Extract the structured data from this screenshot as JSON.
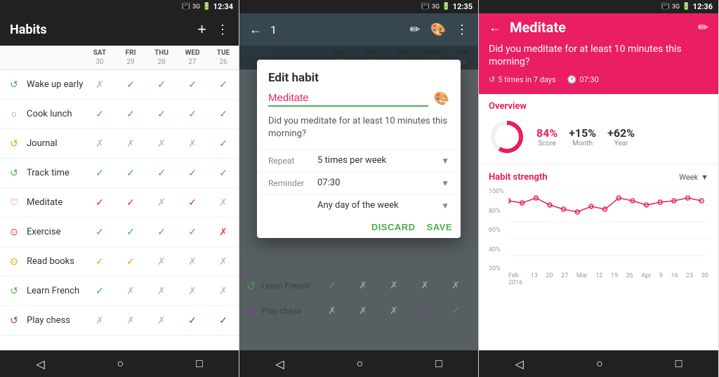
{
  "screen1": {
    "status_time": "12:34",
    "title": "Habits",
    "add_label": "+",
    "menu_label": "⋮",
    "columns": [
      {
        "day": "SAT",
        "num": "30"
      },
      {
        "day": "FRI",
        "num": "29"
      },
      {
        "day": "THU",
        "num": "28"
      },
      {
        "day": "WED",
        "num": "27"
      },
      {
        "day": "TUE",
        "num": "26"
      }
    ],
    "habits": [
      {
        "name": "Wake up early",
        "icon": "↺",
        "icon_color": "#4caf50",
        "checks": [
          "✗",
          "✓",
          "✓",
          "✓",
          "✓"
        ]
      },
      {
        "name": "Cook lunch",
        "icon": "○",
        "icon_color": "#4caf50",
        "checks": [
          "✓",
          "✓",
          "✓",
          "✓",
          "✓"
        ]
      },
      {
        "name": "Journal",
        "icon": "↺",
        "icon_color": "#ff9800",
        "checks": [
          "✗",
          "✗",
          "✗",
          "✗",
          "✓"
        ]
      },
      {
        "name": "Track time",
        "icon": "↺",
        "icon_color": "#4caf50",
        "checks": [
          "✓",
          "✓",
          "✓",
          "✓",
          "✓"
        ]
      },
      {
        "name": "Meditate",
        "icon": "♡",
        "icon_color": "#e91e63",
        "checks": [
          "✓",
          "✓",
          "✗",
          "✓",
          "✗"
        ]
      },
      {
        "name": "Exercise",
        "icon": "⊙",
        "icon_color": "#f44336",
        "checks": [
          "✓",
          "✓",
          "✓",
          "✓",
          "✗"
        ]
      },
      {
        "name": "Read books",
        "icon": "⊙",
        "icon_color": "#ff9800",
        "checks": [
          "✓",
          "✓",
          "✗",
          "✗",
          "✗"
        ]
      },
      {
        "name": "Learn French",
        "icon": "↺",
        "icon_color": "#4caf50",
        "checks": [
          "✓",
          "✗",
          "✗",
          "✗",
          "✗"
        ]
      },
      {
        "name": "Play chess",
        "icon": "↺",
        "icon_color": "#9c27b0",
        "checks": [
          "✗",
          "✗",
          "✗",
          "✓",
          "✓"
        ]
      }
    ]
  },
  "screen2": {
    "status_time": "12:35",
    "counter": "1",
    "dialog": {
      "title": "Edit habit",
      "name_value": "Meditate",
      "name_placeholder": "Meditate",
      "question": "Did you meditate for at least 10 minutes this morning?",
      "repeat_label": "Repeat",
      "repeat_value": "5 times per week",
      "reminder_label": "Reminder",
      "reminder_value": "07:30",
      "schedule_value": "Any day of the week",
      "discard_label": "DISCARD",
      "save_label": "SAVE"
    },
    "bg_habits": [
      {
        "name": "Learn French",
        "icon": "↺",
        "icon_color": "#4caf50"
      },
      {
        "name": "Play chess",
        "icon": "↺",
        "icon_color": "#9c27b0"
      }
    ]
  },
  "screen3": {
    "status_time": "12:36",
    "title": "Meditate",
    "question": "Did you meditate for at least 10 minutes this morning?",
    "frequency": "5 times in 7 days",
    "time": "07:30",
    "overview": {
      "title": "Overview",
      "score_value": "84%",
      "score_label": "Score",
      "month_value": "+15%",
      "month_label": "Month",
      "year_value": "+62%",
      "year_label": "Year",
      "donut_percent": 84
    },
    "strength": {
      "title": "Habit strength",
      "period": "Week",
      "y_labels": [
        "100%",
        "80%",
        "60%",
        "40%",
        "20%"
      ],
      "x_labels": [
        "Feb 2016",
        "13",
        "20",
        "27",
        "Mar",
        "12",
        "19",
        "26",
        "Apr",
        "9",
        "16",
        "23",
        "30"
      ],
      "line_data": [
        85,
        82,
        88,
        80,
        75,
        72,
        78,
        76,
        88,
        84,
        80,
        82,
        85,
        88,
        84,
        86
      ]
    }
  }
}
